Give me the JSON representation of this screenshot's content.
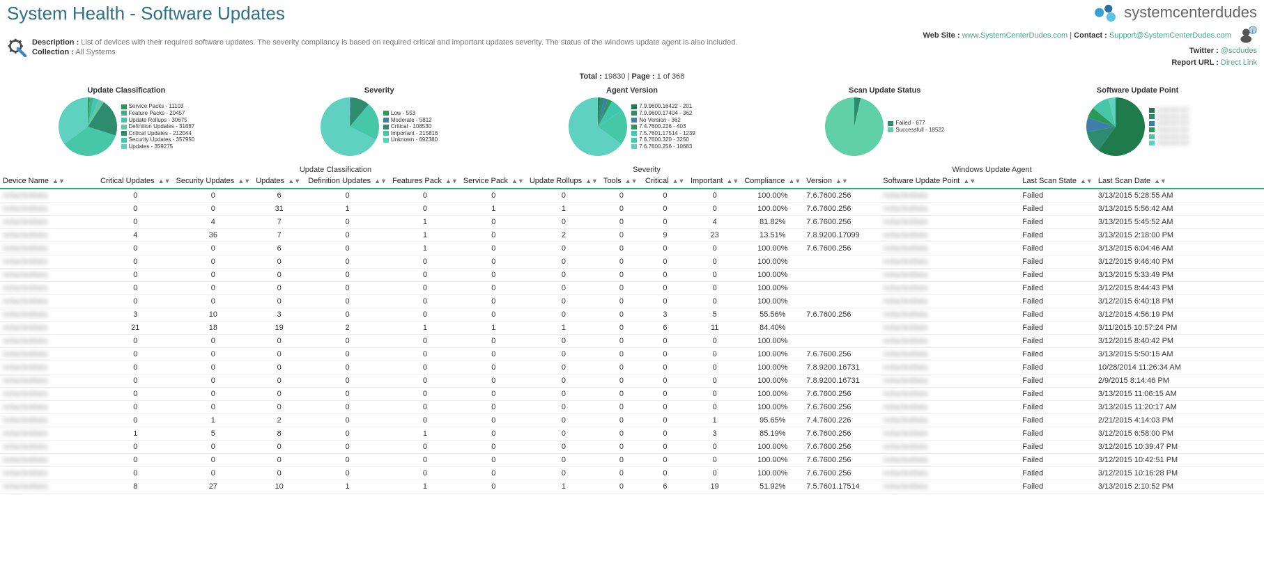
{
  "header": {
    "title": "System Health - Software Updates",
    "logo_text": "systemcenterdudes"
  },
  "meta": {
    "description_label": "Description :",
    "description_text": "List of devices with their required software updates. The severity compliancy is based on required critical and important updates severity. The status of the windows update agent is also included.",
    "collection_label": "Collection :",
    "collection_value": "All Systems",
    "website_label": "Web Site :",
    "website_value": "www.SystemCenterDudes.com",
    "contact_label": "Contact :",
    "contact_value": "Support@SystemCenterDudes.com",
    "twitter_label": "Twitter :",
    "twitter_value": "@scdudes",
    "report_url_label": "Report URL :",
    "report_url_value": "Direct Link"
  },
  "summary": {
    "total_label": "Total :",
    "total_value": "19830",
    "page_label": "Page :",
    "page_value": "1 of 368"
  },
  "group_headers": {
    "g2": "Update Classification",
    "g3": "Severity",
    "g4": "Windows Update Agent"
  },
  "columns": [
    "Device Name",
    "Critical Updates",
    "Security Updates",
    "Updates",
    "Definition Updates",
    "Features Pack",
    "Service Pack",
    "Update Rollups",
    "Tools",
    "Critical",
    "Important",
    "Compliance",
    "Version",
    "Software Update Point",
    "Last Scan State",
    "Last Scan Date"
  ],
  "chart_data": [
    {
      "type": "pie",
      "title": "Update Classification",
      "series": [
        {
          "name": "Service Packs",
          "value": 11103,
          "color": "#2a9958"
        },
        {
          "name": "Feature Packs",
          "value": 20457,
          "color": "#3cb08e"
        },
        {
          "name": "Update Rollups",
          "value": 30675,
          "color": "#3fc7b0"
        },
        {
          "name": "Definition Updates",
          "value": 31687,
          "color": "#60c9a4"
        },
        {
          "name": "Critical Updates",
          "value": 212044,
          "color": "#2e8b6e"
        },
        {
          "name": "Security Updates",
          "value": 357950,
          "color": "#46c8a8"
        },
        {
          "name": "Updates",
          "value": 359275,
          "color": "#5fd1c0"
        }
      ]
    },
    {
      "type": "pie",
      "title": "Severity",
      "series": [
        {
          "name": "Low",
          "value": 553,
          "color": "#2a9958"
        },
        {
          "name": "Moderate",
          "value": 5812,
          "color": "#3d7fa8"
        },
        {
          "name": "Critical",
          "value": 108530,
          "color": "#2e8b6e"
        },
        {
          "name": "Important",
          "value": 215816,
          "color": "#46c8a8"
        },
        {
          "name": "Unknown",
          "value": 692380,
          "color": "#5fd1c0"
        }
      ]
    },
    {
      "type": "pie",
      "title": "Agent Version",
      "series": [
        {
          "name": "7.9.9600.16422",
          "value": 201,
          "color": "#1f7a4c"
        },
        {
          "name": "7.9.9600.17404",
          "value": 362,
          "color": "#2e8b6e"
        },
        {
          "name": "No Version",
          "value": 362,
          "color": "#3d7fa8"
        },
        {
          "name": "7.4.7600.226",
          "value": 403,
          "color": "#2a9958"
        },
        {
          "name": "7.5.7601.17514",
          "value": 1239,
          "color": "#3fc7b0"
        },
        {
          "name": "7.6.7600.320",
          "value": 3250,
          "color": "#46c8a8"
        },
        {
          "name": "7.6.7600.256",
          "value": 10683,
          "color": "#5fd1c0"
        }
      ]
    },
    {
      "type": "pie",
      "title": "Scan Update Status",
      "series": [
        {
          "name": "Failed",
          "value": 677,
          "color": "#2e8b6e"
        },
        {
          "name": "Successfull",
          "value": 18522,
          "color": "#60d0a8"
        }
      ]
    },
    {
      "type": "pie",
      "title": "Software Update Point",
      "series": [
        {
          "name": "(redacted)",
          "value": 60,
          "color": "#1f7a4c"
        },
        {
          "name": "(redacted)",
          "value": 12,
          "color": "#2e8b6e"
        },
        {
          "name": "(redacted)",
          "value": 8,
          "color": "#3d7fa8"
        },
        {
          "name": "(redacted)",
          "value": 6,
          "color": "#2a9958"
        },
        {
          "name": "(redacted)",
          "value": 10,
          "color": "#46c8a8"
        },
        {
          "name": "(redacted)",
          "value": 4,
          "color": "#5fd1c0"
        }
      ]
    }
  ],
  "rows": [
    {
      "d": "XXXXXXXX",
      "cu": 0,
      "su": 0,
      "u": 6,
      "du": 0,
      "fp": 0,
      "sp": 0,
      "ur": 0,
      "t": 0,
      "cr": 0,
      "im": 0,
      "cp": "100.00%",
      "v": "7.6.7600.256",
      "sup": "XXXXXXXX",
      "ls": "Failed",
      "ld": "3/13/2015 5:28:55 AM"
    },
    {
      "d": "XXXXXXXX",
      "cu": 0,
      "su": 0,
      "u": 31,
      "du": 1,
      "fp": 0,
      "sp": 1,
      "ur": 1,
      "t": 0,
      "cr": 0,
      "im": 0,
      "cp": "100.00%",
      "v": "7.6.7600.256",
      "sup": "XXXXXXXX",
      "ls": "Failed",
      "ld": "3/13/2015 5:56:42 AM"
    },
    {
      "d": "XXXXXXXX",
      "cu": 0,
      "su": 4,
      "u": 7,
      "du": 0,
      "fp": 1,
      "sp": 0,
      "ur": 0,
      "t": 0,
      "cr": 0,
      "im": 4,
      "cp": "81.82%",
      "v": "7.6.7600.256",
      "sup": "XXXXXXXX",
      "ls": "Failed",
      "ld": "3/13/2015 5:45:52 AM"
    },
    {
      "d": "XXXXXXXX",
      "cu": 4,
      "su": 36,
      "u": 7,
      "du": 0,
      "fp": 1,
      "sp": 0,
      "ur": 2,
      "t": 0,
      "cr": 9,
      "im": 23,
      "cp": "13.51%",
      "v": "7.8.9200.17099",
      "sup": "XXXXXXXX",
      "ls": "Failed",
      "ld": "3/13/2015 2:18:00 PM"
    },
    {
      "d": "XXXXXXXX",
      "cu": 0,
      "su": 0,
      "u": 6,
      "du": 0,
      "fp": 1,
      "sp": 0,
      "ur": 0,
      "t": 0,
      "cr": 0,
      "im": 0,
      "cp": "100.00%",
      "v": "7.6.7600.256",
      "sup": "XXXXXXXX",
      "ls": "Failed",
      "ld": "3/13/2015 6:04:46 AM"
    },
    {
      "d": "XXXXXXXX",
      "cu": 0,
      "su": 0,
      "u": 0,
      "du": 0,
      "fp": 0,
      "sp": 0,
      "ur": 0,
      "t": 0,
      "cr": 0,
      "im": 0,
      "cp": "100.00%",
      "v": "",
      "sup": "XXXXXXXX",
      "ls": "Failed",
      "ld": "3/12/2015 9:46:40 PM"
    },
    {
      "d": "XXXXXXXX",
      "cu": 0,
      "su": 0,
      "u": 0,
      "du": 0,
      "fp": 0,
      "sp": 0,
      "ur": 0,
      "t": 0,
      "cr": 0,
      "im": 0,
      "cp": "100.00%",
      "v": "",
      "sup": "XXXXXXXX",
      "ls": "Failed",
      "ld": "3/13/2015 5:33:49 PM"
    },
    {
      "d": "XXXXXXXX",
      "cu": 0,
      "su": 0,
      "u": 0,
      "du": 0,
      "fp": 0,
      "sp": 0,
      "ur": 0,
      "t": 0,
      "cr": 0,
      "im": 0,
      "cp": "100.00%",
      "v": "",
      "sup": "XXXXXXXX",
      "ls": "Failed",
      "ld": "3/12/2015 8:44:43 PM"
    },
    {
      "d": "XXXXXXXX",
      "cu": 0,
      "su": 0,
      "u": 0,
      "du": 0,
      "fp": 0,
      "sp": 0,
      "ur": 0,
      "t": 0,
      "cr": 0,
      "im": 0,
      "cp": "100.00%",
      "v": "",
      "sup": "XXXXXXXX",
      "ls": "Failed",
      "ld": "3/12/2015 6:40:18 PM"
    },
    {
      "d": "XXXXXXXX",
      "cu": 3,
      "su": 10,
      "u": 3,
      "du": 0,
      "fp": 0,
      "sp": 0,
      "ur": 0,
      "t": 0,
      "cr": 3,
      "im": 5,
      "cp": "55.56%",
      "v": "7.6.7600.256",
      "sup": "XXXXXXXX",
      "ls": "Failed",
      "ld": "3/12/2015 4:56:19 PM"
    },
    {
      "d": "XXXXXXXX",
      "cu": 21,
      "su": 18,
      "u": 19,
      "du": 2,
      "fp": 1,
      "sp": 1,
      "ur": 1,
      "t": 0,
      "cr": 6,
      "im": 11,
      "cp": "84.40%",
      "v": "",
      "sup": "XXXXXXXX",
      "ls": "Failed",
      "ld": "3/11/2015 10:57:24 PM"
    },
    {
      "d": "XXXXXXXX",
      "cu": 0,
      "su": 0,
      "u": 0,
      "du": 0,
      "fp": 0,
      "sp": 0,
      "ur": 0,
      "t": 0,
      "cr": 0,
      "im": 0,
      "cp": "100.00%",
      "v": "",
      "sup": "XXXXXXXX",
      "ls": "Failed",
      "ld": "3/12/2015 8:40:42 PM"
    },
    {
      "d": "XXXXXXXX",
      "cu": 0,
      "su": 0,
      "u": 0,
      "du": 0,
      "fp": 0,
      "sp": 0,
      "ur": 0,
      "t": 0,
      "cr": 0,
      "im": 0,
      "cp": "100.00%",
      "v": "7.6.7600.256",
      "sup": "XXXXXXXX",
      "ls": "Failed",
      "ld": "3/13/2015 5:50:15 AM"
    },
    {
      "d": "XXXXXXXX",
      "cu": 0,
      "su": 0,
      "u": 0,
      "du": 0,
      "fp": 0,
      "sp": 0,
      "ur": 0,
      "t": 0,
      "cr": 0,
      "im": 0,
      "cp": "100.00%",
      "v": "7.8.9200.16731",
      "sup": "XXXXXXXX",
      "ls": "Failed",
      "ld": "10/28/2014 11:26:34 AM"
    },
    {
      "d": "XXXXXXXX",
      "cu": 0,
      "su": 0,
      "u": 0,
      "du": 0,
      "fp": 0,
      "sp": 0,
      "ur": 0,
      "t": 0,
      "cr": 0,
      "im": 0,
      "cp": "100.00%",
      "v": "7.8.9200.16731",
      "sup": "XXXXXXXX",
      "ls": "Failed",
      "ld": "2/9/2015 8:14:46 PM"
    },
    {
      "d": "XXXXXXXX",
      "cu": 0,
      "su": 0,
      "u": 0,
      "du": 0,
      "fp": 0,
      "sp": 0,
      "ur": 0,
      "t": 0,
      "cr": 0,
      "im": 0,
      "cp": "100.00%",
      "v": "7.6.7600.256",
      "sup": "XXXXXXXX",
      "ls": "Failed",
      "ld": "3/13/2015 11:06:15 AM"
    },
    {
      "d": "XXXXXXXX",
      "cu": 0,
      "su": 0,
      "u": 0,
      "du": 0,
      "fp": 0,
      "sp": 0,
      "ur": 0,
      "t": 0,
      "cr": 0,
      "im": 0,
      "cp": "100.00%",
      "v": "7.6.7600.256",
      "sup": "XXXXXXXX",
      "ls": "Failed",
      "ld": "3/13/2015 11:20:17 AM"
    },
    {
      "d": "XXXXXXXX",
      "cu": 0,
      "su": 1,
      "u": 2,
      "du": 0,
      "fp": 0,
      "sp": 0,
      "ur": 0,
      "t": 0,
      "cr": 0,
      "im": 1,
      "cp": "95.65%",
      "v": "7.4.7600.226",
      "sup": "XXXXXXXX",
      "ls": "Failed",
      "ld": "2/21/2015 4:14:03 PM"
    },
    {
      "d": "XXXXXXXX",
      "cu": 1,
      "su": 5,
      "u": 8,
      "du": 0,
      "fp": 1,
      "sp": 0,
      "ur": 0,
      "t": 0,
      "cr": 0,
      "im": 3,
      "cp": "85.19%",
      "v": "7.6.7600.256",
      "sup": "XXXXXXXX",
      "ls": "Failed",
      "ld": "3/12/2015 6:58:00 PM"
    },
    {
      "d": "XXXXXXXX",
      "cu": 0,
      "su": 0,
      "u": 0,
      "du": 0,
      "fp": 0,
      "sp": 0,
      "ur": 0,
      "t": 0,
      "cr": 0,
      "im": 0,
      "cp": "100.00%",
      "v": "7.6.7600.256",
      "sup": "XXXXXXXX",
      "ls": "Failed",
      "ld": "3/12/2015 10:39:47 PM"
    },
    {
      "d": "XXXXXXXX",
      "cu": 0,
      "su": 0,
      "u": 0,
      "du": 0,
      "fp": 0,
      "sp": 0,
      "ur": 0,
      "t": 0,
      "cr": 0,
      "im": 0,
      "cp": "100.00%",
      "v": "7.6.7600.256",
      "sup": "XXXXXXXX",
      "ls": "Failed",
      "ld": "3/12/2015 10:42:51 PM"
    },
    {
      "d": "XXXXXXXX",
      "cu": 0,
      "su": 0,
      "u": 0,
      "du": 0,
      "fp": 0,
      "sp": 0,
      "ur": 0,
      "t": 0,
      "cr": 0,
      "im": 0,
      "cp": "100.00%",
      "v": "7.6.7600.256",
      "sup": "XXXXXXXX",
      "ls": "Failed",
      "ld": "3/12/2015 10:16:28 PM"
    },
    {
      "d": "XXXXXXXX",
      "cu": 8,
      "su": 27,
      "u": 10,
      "du": 1,
      "fp": 1,
      "sp": 0,
      "ur": 1,
      "t": 0,
      "cr": 6,
      "im": 19,
      "cp": "51.92%",
      "v": "7.5.7601.17514",
      "sup": "XXXXXXXX",
      "ls": "Failed",
      "ld": "3/13/2015 2:10:52 PM"
    }
  ]
}
